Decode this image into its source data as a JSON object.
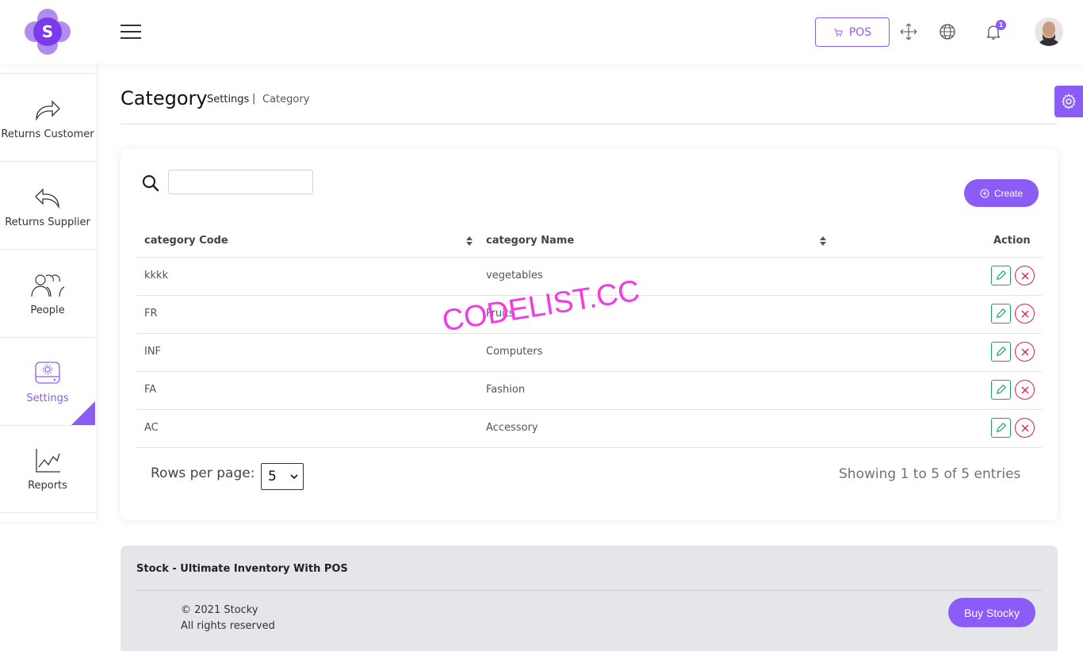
{
  "header": {
    "logo_letter": "S",
    "pos_label": "POS",
    "notification_count": "1"
  },
  "sidebar": {
    "items": [
      {
        "label": "Returns Customer",
        "icon": "share-forward-icon"
      },
      {
        "label": "Returns Supplier",
        "icon": "reply-back-icon"
      },
      {
        "label": "People",
        "icon": "people-icon"
      },
      {
        "label": "Settings",
        "icon": "settings-drive-icon",
        "active": true
      },
      {
        "label": "Reports",
        "icon": "line-chart-icon"
      }
    ]
  },
  "page": {
    "title": "Category",
    "breadcrumb_parent": "Settings",
    "breadcrumb_separator": "|",
    "breadcrumb_current": "Category"
  },
  "table": {
    "search_placeholder": "",
    "create_label": "Create",
    "columns": [
      "category Code",
      "category Name",
      "Action"
    ],
    "rows": [
      {
        "code": "kkkk",
        "name": "vegetables"
      },
      {
        "code": "FR",
        "name": "Fruits"
      },
      {
        "code": "INF",
        "name": "Computers"
      },
      {
        "code": "FA",
        "name": "Fashion"
      },
      {
        "code": "AC",
        "name": "Accessory"
      }
    ],
    "rows_per_page_label": "Rows per page:",
    "rows_per_page_value": "5",
    "showing_text": "Showing 1 to 5 of 5 entries"
  },
  "watermark": "CODELIST.CC",
  "footer": {
    "title": "Stock - Ultimate Inventory With POS",
    "copyright": "© 2021 Stocky",
    "rights": "All rights reserved",
    "buy_label": "Buy Stocky"
  },
  "colors": {
    "accent": "#8b5cf6",
    "edit": "#22a35a",
    "delete": "#e11d48",
    "watermark": "#f03ce0"
  }
}
